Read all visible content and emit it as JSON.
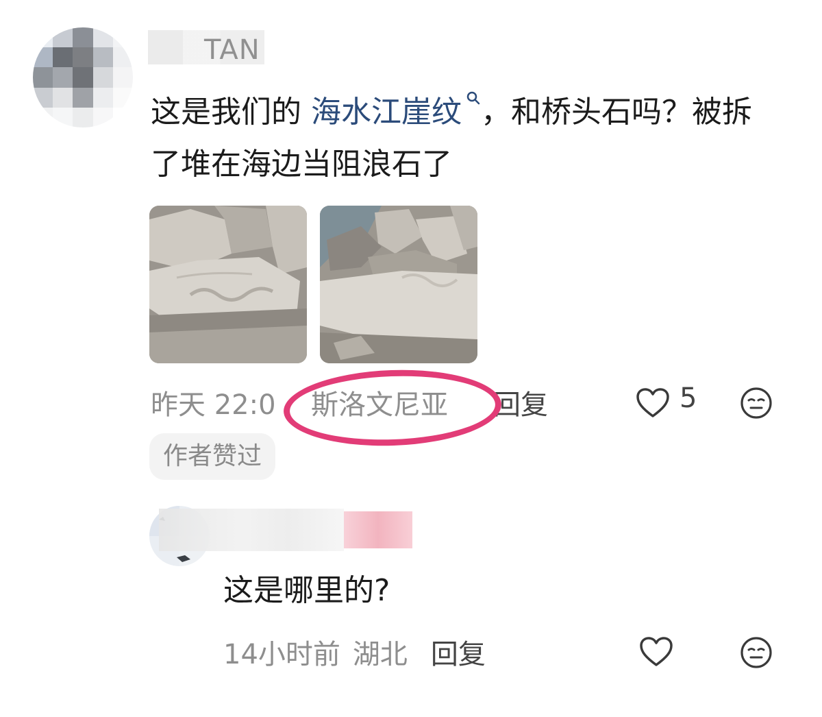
{
  "main_comment": {
    "username_suffix": "TAN",
    "text_prefix": "这是我们的 ",
    "search_link": "海水江崖纹",
    "text_suffix": "，和桥头石吗？被拆了堆在海边当阻浪石了",
    "time": "昨天 22:0",
    "location": "斯洛文尼亚",
    "reply_label": "回复",
    "like_count": "5",
    "author_liked_badge": "作者赞过"
  },
  "reply_comment": {
    "text": "这是哪里的?",
    "time": "14小时前",
    "location": "湖北",
    "reply_label": "回复"
  },
  "colors": {
    "link": "#2b4b7a",
    "highlight_circle": "#e23c77",
    "meta_text": "#8e8e8e"
  },
  "icons": {
    "like": "heart-outline-icon",
    "dislike": "meh-face-icon",
    "search": "search-icon"
  }
}
